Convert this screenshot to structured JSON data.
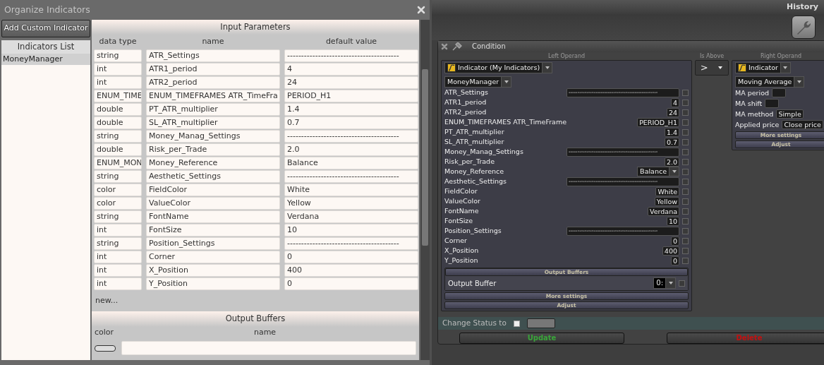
{
  "organize_window": {
    "title": "Organize Indicators",
    "add_button": "Add Custom Indicator",
    "indicators_list": {
      "title": "Indicators List",
      "items": [
        {
          "label": "MoneyManager",
          "selected": true
        }
      ]
    },
    "input_parameters": {
      "title": "Input Parameters",
      "columns": [
        "data type",
        "name",
        "default value"
      ],
      "rows": [
        {
          "data_type": "string",
          "name": "ATR_Settings",
          "default_value": "----------------------------------------"
        },
        {
          "data_type": "int",
          "name": "ATR1_period",
          "default_value": "4"
        },
        {
          "data_type": "int",
          "name": "ATR2_period",
          "default_value": "24"
        },
        {
          "data_type": "ENUM_TIME",
          "name": "ENUM_TIMEFRAMES   ATR_TimeFra",
          "default_value": "PERIOD_H1"
        },
        {
          "data_type": "double",
          "name": "PT_ATR_multiplier",
          "default_value": "1.4"
        },
        {
          "data_type": "double",
          "name": "SL_ATR_multiplier",
          "default_value": "0.7"
        },
        {
          "data_type": "string",
          "name": "Money_Manag_Settings",
          "default_value": "----------------------------------------"
        },
        {
          "data_type": "double",
          "name": "Risk_per_Trade",
          "default_value": "2.0"
        },
        {
          "data_type": "ENUM_MON",
          "name": "Money_Reference",
          "default_value": "Balance"
        },
        {
          "data_type": "string",
          "name": "Aesthetic_Settings",
          "default_value": "----------------------------------------"
        },
        {
          "data_type": "color",
          "name": "FieldColor",
          "default_value": "White"
        },
        {
          "data_type": "color",
          "name": "ValueColor",
          "default_value": "Yellow"
        },
        {
          "data_type": "string",
          "name": "FontName",
          "default_value": "Verdana"
        },
        {
          "data_type": "int",
          "name": "FontSize",
          "default_value": "10"
        },
        {
          "data_type": "string",
          "name": "Position_Settings",
          "default_value": "----------------------------------------"
        },
        {
          "data_type": "int",
          "name": "Corner",
          "default_value": "0"
        },
        {
          "data_type": "int",
          "name": "X_Position",
          "default_value": "400"
        },
        {
          "data_type": "int",
          "name": "Y_Position",
          "default_value": "0"
        }
      ],
      "new_link": "new..."
    },
    "output_buffers": {
      "title": "Output Buffers",
      "columns": [
        "color",
        "name"
      ]
    }
  },
  "history": {
    "title": "History"
  },
  "condition": {
    "title": "Condition",
    "left_operand": {
      "label": "Left Operand",
      "source": "Indicator (My Indicators)",
      "indicator": "MoneyManager",
      "params": [
        {
          "name": "ATR_Settings",
          "value": "--------------------------------------------------",
          "kind": "separator",
          "checked": false
        },
        {
          "name": "ATR1_period",
          "value": "4",
          "kind": "field",
          "checked": false
        },
        {
          "name": "ATR2_period",
          "value": "24",
          "kind": "field",
          "checked": false
        },
        {
          "name": "ENUM_TIMEFRAMES ATR_TimeFrame",
          "value": "PERIOD_H1",
          "kind": "field",
          "checked": false
        },
        {
          "name": "PT_ATR_multiplier",
          "value": "1.4",
          "kind": "field",
          "checked": false
        },
        {
          "name": "SL_ATR_multiplier",
          "value": "0.7",
          "kind": "field",
          "checked": false
        },
        {
          "name": "Money_Manag_Settings",
          "value": "--------------------------------------------------",
          "kind": "separator",
          "checked": false
        },
        {
          "name": "Risk_per_Trade",
          "value": "2.0",
          "kind": "field",
          "checked": false
        },
        {
          "name": "Money_Reference",
          "value": "Balance",
          "kind": "dropdown",
          "checked": false
        },
        {
          "name": "Aesthetic_Settings",
          "value": "--------------------------------------------------",
          "kind": "separator",
          "checked": false
        },
        {
          "name": "FieldColor",
          "value": "White",
          "kind": "field",
          "checked": false
        },
        {
          "name": "ValueColor",
          "value": "Yellow",
          "kind": "field",
          "checked": false
        },
        {
          "name": "FontName",
          "value": "Verdana",
          "kind": "field",
          "checked": false
        },
        {
          "name": "FontSize",
          "value": "10",
          "kind": "field",
          "checked": false
        },
        {
          "name": "Position_Settings",
          "value": "--------------------------------------------------",
          "kind": "separator",
          "checked": false
        },
        {
          "name": "Corner",
          "value": "0",
          "kind": "field",
          "checked": false
        },
        {
          "name": "X_Position",
          "value": "400",
          "kind": "field",
          "checked": false
        },
        {
          "name": "Y_Position",
          "value": "0",
          "kind": "field",
          "checked": false
        }
      ],
      "output_buffers": {
        "title": "Output Buffers",
        "label": "Output Buffer",
        "value": "0:",
        "checked": false
      },
      "more_settings": "More settings",
      "adjust": "Adjust"
    },
    "comparator": {
      "label": "Is Above",
      "value": ">"
    },
    "right_operand": {
      "label": "Right Operand",
      "source": "Indicator",
      "indicator": "Moving Average",
      "params": [
        {
          "name": "MA period",
          "kind": "field"
        },
        {
          "name": "MA shift",
          "kind": "field"
        },
        {
          "name": "MA method",
          "value": "Simple",
          "kind": "field"
        },
        {
          "name": "Applied price",
          "value": "Close price",
          "kind": "field"
        }
      ],
      "more_settings": "More settings",
      "adjust": "Adjust"
    },
    "change_status": {
      "label": "Change Status to",
      "checked": false
    },
    "buttons": [
      {
        "label": "Update",
        "kind": "update"
      },
      {
        "label": "Delete",
        "kind": "delete"
      }
    ]
  }
}
